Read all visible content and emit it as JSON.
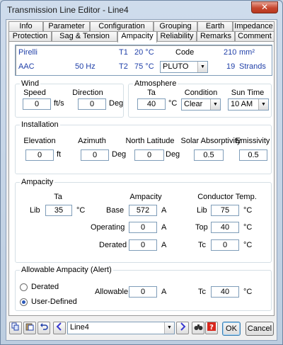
{
  "window": {
    "title": "Transmission Line Editor - Line4",
    "close_glyph": "✕"
  },
  "tabs_row1": [
    "Info",
    "Parameter",
    "Configuration",
    "Grouping",
    "Earth",
    "Impedance"
  ],
  "tabs_row2": [
    "Protection",
    "Sag & Tension",
    "Ampacity",
    "Reliability",
    "Remarks",
    "Comment"
  ],
  "active_tab": "Ampacity",
  "conductor": {
    "manufacturer": "Pirelli",
    "type": "AAC",
    "frequency": "50 Hz",
    "t1_label": "T1",
    "t1_value": "20 °C",
    "t2_label": "T2",
    "t2_value": "75 °C",
    "code_label": "Code",
    "code_value": "PLUTO",
    "area_value": "210",
    "area_unit": "mm²",
    "strands_value": "19",
    "strands_unit": "Strands"
  },
  "wind": {
    "title": "Wind",
    "speed_label": "Speed",
    "speed_value": "0",
    "speed_unit": "ft/s",
    "direction_label": "Direction",
    "direction_value": "0",
    "direction_unit": "Deg"
  },
  "atmosphere": {
    "title": "Atmosphere",
    "ta_label": "Ta",
    "ta_value": "40",
    "ta_unit": "°C",
    "condition_label": "Condition",
    "condition_value": "Clear",
    "suntime_label": "Sun Time",
    "suntime_value": "10 AM"
  },
  "installation": {
    "title": "Installation",
    "elevation_label": "Elevation",
    "elevation_value": "0",
    "elevation_unit": "ft",
    "azimuth_label": "Azimuth",
    "azimuth_value": "0",
    "azimuth_unit": "Deg",
    "latitude_label": "North Latitude",
    "latitude_value": "0",
    "latitude_unit": "Deg",
    "absorptivity_label": "Solar Absorptivity",
    "absorptivity_value": "0.5",
    "emissivity_label": "Emissivity",
    "emissivity_value": "0.5"
  },
  "ampacity": {
    "title": "Ampacity",
    "ta_header": "Ta",
    "ampacity_header": "Ampacity",
    "conductor_temp_header": "Conductor Temp.",
    "lib_label": "Lib",
    "ta_lib_value": "35",
    "ta_unit": "°C",
    "base_label": "Base",
    "base_value": "572",
    "operating_label": "Operating",
    "operating_value": "0",
    "derated_label": "Derated",
    "derated_value": "0",
    "amp_unit": "A",
    "ct_lib_label": "Lib",
    "ct_lib_value": "75",
    "top_label": "Top",
    "top_value": "40",
    "tc_label": "Tc",
    "tc_value": "0",
    "ct_unit": "°C"
  },
  "alert": {
    "title": "Allowable Ampacity (Alert)",
    "derated_option": "Derated",
    "user_defined_option": "User-Defined",
    "allowable_label": "Allowable",
    "allowable_value": "0",
    "allowable_unit": "A",
    "tc_label": "Tc",
    "tc_value": "40",
    "tc_unit": "°C"
  },
  "footer": {
    "line_value": "Line4",
    "ok_label": "OK",
    "cancel_label": "Cancel",
    "icons": [
      "copy-icon",
      "paste-icon",
      "undo-icon",
      "prev-icon",
      "next-icon",
      "find-icon",
      "help-icon"
    ]
  }
}
